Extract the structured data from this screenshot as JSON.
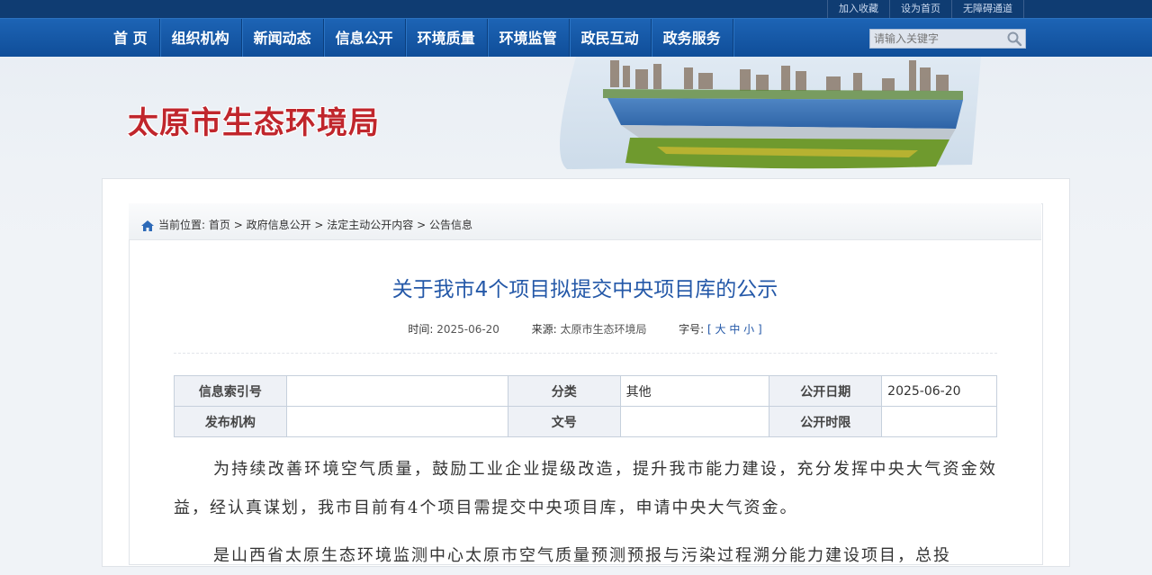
{
  "toplinks": {
    "favorite": "加入收藏",
    "homepage": "设为首页",
    "accessible": "无障碍通道"
  },
  "nav": {
    "items": [
      "首 页",
      "组织机构",
      "新闻动态",
      "信息公开",
      "环境质量",
      "环境监管",
      "政民互动",
      "政务服务"
    ]
  },
  "search": {
    "placeholder": "请输入关键字"
  },
  "site": {
    "title": "太原市生态环境局"
  },
  "breadcrumb": {
    "label": "当前位置:",
    "items": [
      "首页",
      "政府信息公开",
      "法定主动公开内容",
      "公告信息"
    ],
    "separator": " > "
  },
  "article": {
    "title": "关于我市4个项目拟提交中央项目库的公示",
    "time_label": "时间:",
    "time": "2025-06-20",
    "source_label": "来源:",
    "source": "太原市生态环境局",
    "fontsize_label": "字号:",
    "fontsize_options": "[ 大 中 小 ]"
  },
  "info_table": {
    "index_label": "信息索引号",
    "index_value": "",
    "category_label": "分类",
    "category_value": "其他",
    "date_label": "公开日期",
    "date_value": "2025-06-20",
    "org_label": "发布机构",
    "org_value": "",
    "docno_label": "文号",
    "docno_value": "",
    "period_label": "公开时限",
    "period_value": ""
  },
  "body": {
    "p1": "为持续改善环境空气质量，鼓励工业企业提级改造，提升我市能力建设，充分发挥中央大气资金效益，经认真谋划，我市目前有4个项目需提交中央项目库，申请中央大气资金。",
    "p2": "是山西省太原生态环境监测中心太原市空气质量预测预报与污染过程溯分能力建设项目，总投"
  }
}
